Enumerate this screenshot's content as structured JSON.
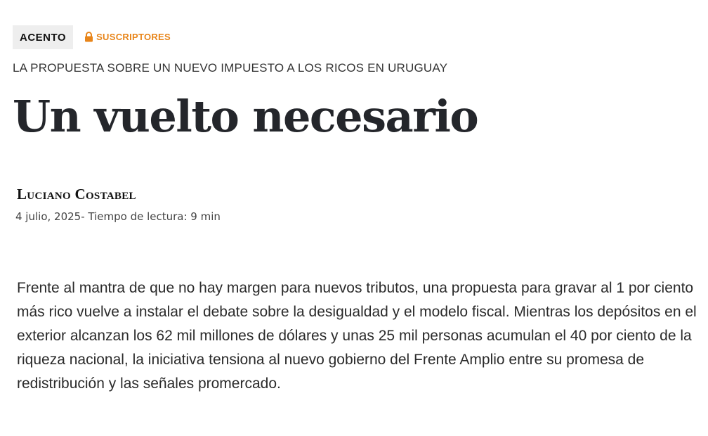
{
  "section_tag": "ACENTO",
  "subscribers": {
    "icon": "lock-icon",
    "label": "SUSCRIPTORES",
    "color": "#e8851a"
  },
  "kicker": "LA PROPUESTA SOBRE UN NUEVO IMPUESTO A LOS RICOS EN URUGUAY",
  "headline": "Un vuelto necesario",
  "author": "Luciano Costabel",
  "meta": {
    "date": "4 julio, 2025",
    "reading_time": "- Tiempo de lectura: 9 min"
  },
  "lead": "Frente al mantra de que no hay margen para nuevos tributos, una propuesta para gravar al 1 por ciento más rico vuelve a instalar el debate sobre la desigualdad y el modelo fiscal. Mientras los depósitos en el exterior alcanzan los 62 mil millones de dólares y unas 25 mil personas acumulan el 40 por ciento de la riqueza nacional, la iniciativa tensiona al nuevo gobierno del Frente Amplio entre su promesa de redistribución y las señales promercado."
}
